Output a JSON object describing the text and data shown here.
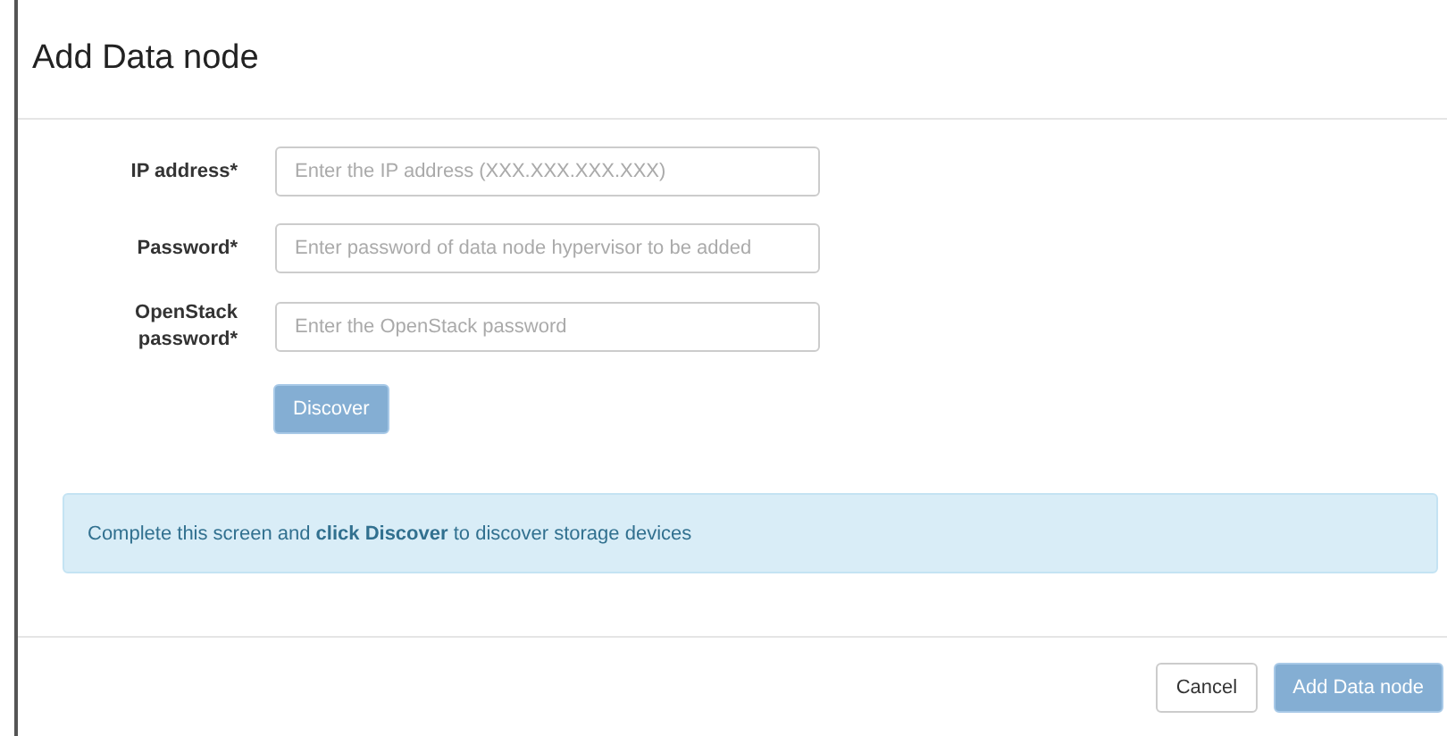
{
  "dialog": {
    "title": "Add Data node"
  },
  "fields": [
    {
      "label": "IP address*",
      "placeholder": "Enter the IP address (XXX.XXX.XXX.XXX)"
    },
    {
      "label": "Password*",
      "placeholder": "Enter password of data node hypervisor to be added"
    },
    {
      "label": "OpenStack password*",
      "placeholder": "Enter the OpenStack password"
    }
  ],
  "discover_button": {
    "label": "Discover",
    "disabled": true
  },
  "info": "Complete this screen and **click Discover** to discover storage devices",
  "footer_buttons": [
    {
      "label": "Cancel",
      "kind": "default",
      "disabled": false
    },
    {
      "label": "Add Data node",
      "kind": "primary",
      "disabled": true
    }
  ]
}
